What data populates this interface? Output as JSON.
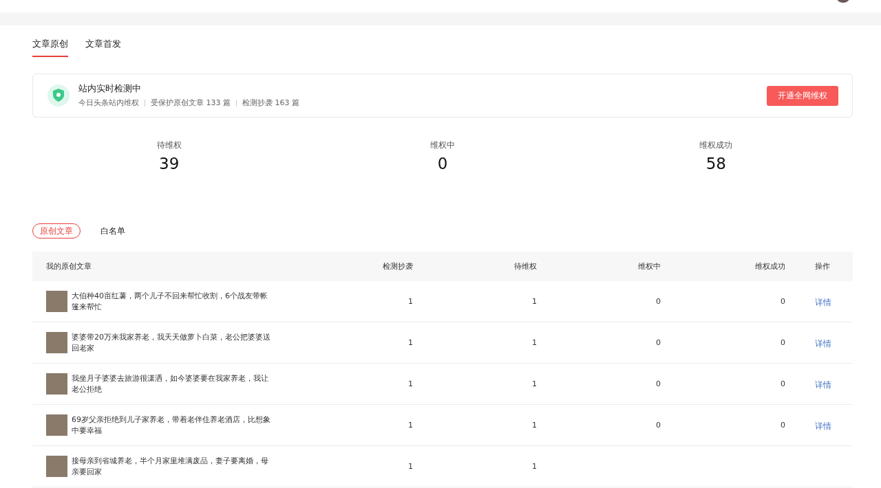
{
  "tabs": [
    {
      "label": "文章原创",
      "selected": true
    },
    {
      "label": "文章首发",
      "selected": false
    }
  ],
  "status_card": {
    "title": "站内实时检测中",
    "details": [
      "今日头条站内维权",
      "受保护原创文章 133 篇",
      "检测抄袭 163 篇"
    ],
    "button": "开通全网维权"
  },
  "stats": [
    {
      "label": "待维权",
      "value": "39"
    },
    {
      "label": "维权中",
      "value": "0"
    },
    {
      "label": "维权成功",
      "value": "58"
    }
  ],
  "filters": [
    {
      "label": "原创文章",
      "selected": true
    },
    {
      "label": "白名单",
      "selected": false
    }
  ],
  "table": {
    "columns": [
      "我的原创文章",
      "检测抄袭",
      "待维权",
      "维权中",
      "维权成功",
      "操作"
    ],
    "rows": [
      {
        "cells": [
          "大伯种40亩红薯，两个儿子不回来帮忙收割，6个战友带帐篷来帮忙",
          "1",
          "1",
          "0",
          "0",
          "详情"
        ]
      },
      {
        "cells": [
          "婆婆带20万来我家养老，我天天做萝卜白菜，老公把婆婆送回老家",
          "1",
          "1",
          "0",
          "0",
          "详情"
        ]
      },
      {
        "cells": [
          "我坐月子婆婆去旅游很潇洒，如今婆婆要在我家养老，我让老公拒绝",
          "1",
          "1",
          "0",
          "0",
          "详情"
        ]
      },
      {
        "cells": [
          "69岁父亲拒绝到儿子家养老，带着老伴住养老酒店，比想象中要幸福",
          "1",
          "1",
          "0",
          "0",
          "详情"
        ]
      },
      {
        "cells": [
          "接母亲到省城养老，半个月家里堆满废品，妻子要离婚，母亲要回家",
          "1",
          "1"
        ]
      }
    ]
  }
}
